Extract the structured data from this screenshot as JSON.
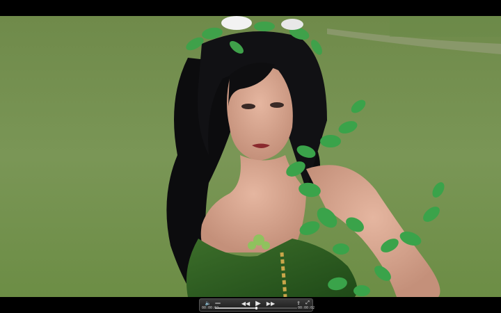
{
  "player": {
    "current_time": "00:00:02",
    "duration": "00:00:02",
    "progress_fraction": 0.5,
    "accent_color": "#d8d8d8"
  },
  "icons": {
    "volume": "volume-icon",
    "rewind": "rewind-icon",
    "play": "play-icon",
    "fast_forward": "fast-forward-icon",
    "share": "share-icon",
    "fullscreen": "fullscreen-icon"
  },
  "glyphs": {
    "volume": "🔈",
    "rewind": "◀◀",
    "play": "▶",
    "fast_forward": "▶▶",
    "share": "⇪",
    "fullscreen": "⤢"
  }
}
